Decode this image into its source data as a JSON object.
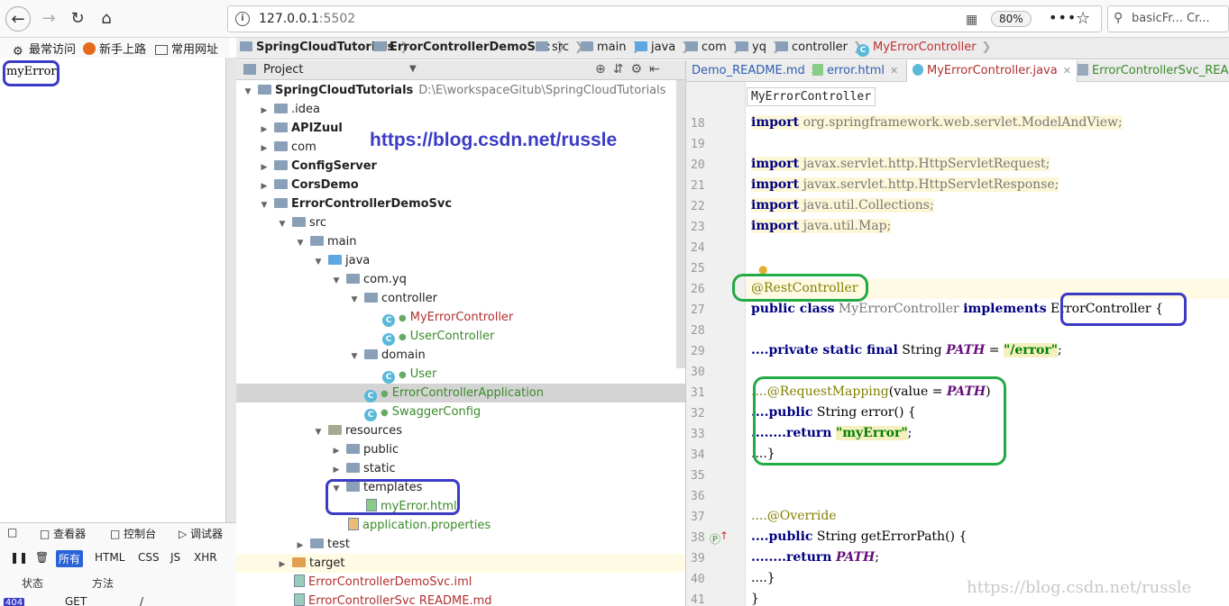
{
  "browser": {
    "url_host": "127.0.0.1",
    "url_port": ":5502",
    "zoom": "80%",
    "search_text": "basicFr... Cr..."
  },
  "bookmarks": [
    {
      "label": "最常访问"
    },
    {
      "label": "新手上路"
    },
    {
      "label": "常用网址"
    }
  ],
  "page": {
    "text": "myError"
  },
  "devtools": {
    "tabs": [
      "查看器",
      "控制台",
      "调试器"
    ],
    "filters": [
      "所有",
      "HTML",
      "CSS",
      "JS",
      "XHR"
    ],
    "columns": [
      "状态",
      "方法"
    ],
    "row": {
      "status": "404",
      "method": "GET",
      "path": "/"
    }
  },
  "breadcrumbs": [
    "SpringCloudTutorials",
    "ErrorControllerDemoSvc",
    "src",
    "main",
    "java",
    "com",
    "yq",
    "controller",
    "MyErrorController"
  ],
  "project": {
    "header": "Project",
    "tree": [
      {
        "label": "SpringCloudTutorials",
        "extra": "D:\\E\\workspaceGitub\\SpringCloudTutorials"
      },
      {
        "label": ".idea"
      },
      {
        "label": "APIZuul"
      },
      {
        "label": "com"
      },
      {
        "label": "ConfigServer"
      },
      {
        "label": "CorsDemo"
      },
      {
        "label": "ErrorControllerDemoSvc"
      },
      {
        "label": "src"
      },
      {
        "label": "main"
      },
      {
        "label": "java"
      },
      {
        "label": "com.yq"
      },
      {
        "label": "controller"
      },
      {
        "label": "MyErrorController"
      },
      {
        "label": "UserController"
      },
      {
        "label": "domain"
      },
      {
        "label": "User"
      },
      {
        "label": "ErrorControllerApplication"
      },
      {
        "label": "SwaggerConfig"
      },
      {
        "label": "resources"
      },
      {
        "label": "public"
      },
      {
        "label": "static"
      },
      {
        "label": "templates"
      },
      {
        "label": "myError.html"
      },
      {
        "label": "application.properties"
      },
      {
        "label": "test"
      },
      {
        "label": "target"
      },
      {
        "label": "ErrorControllerDemoSvc.iml"
      },
      {
        "label": "ErrorControllerSvc README.md"
      }
    ],
    "watermark": "https://blog.csdn.net/russle"
  },
  "editor": {
    "tabs": [
      "Demo_README.md",
      "error.html",
      "MyErrorController.java",
      "ErrorControllerSvc_READM"
    ],
    "tooltip": "MyErrorController",
    "line_numbers": [
      "18",
      "19",
      "20",
      "21",
      "22",
      "23",
      "24",
      "25",
      "26",
      "27",
      "28",
      "29",
      "30",
      "31",
      "32",
      "33",
      "34",
      "35",
      "36",
      "37",
      "38",
      "39",
      "40",
      "41"
    ],
    "lines": {
      "l18_pkg": "org.springframework.web.servlet.ModelAndView;",
      "l20_pkg": "javax.servlet.http.HttpServletRequest;",
      "l21_pkg": "javax.servlet.http.HttpServletResponse;",
      "l22_pkg": "java.util.Collections;",
      "l23_pkg": "java.util.Map;",
      "import_kw": "import",
      "l26_ann": "@RestController",
      "l27_a": "public class",
      "l27_b": " MyErrorController ",
      "l27_c": "implements",
      "l27_d": " ErrorController {",
      "l29_a": "....private static final",
      "l29_b": " String ",
      "l29_c": "PATH",
      "l29_d": " = ",
      "l29_e": "\"/error\"",
      "l29_f": ";",
      "l31_ann": "....@RequestMapping",
      "l31_b": "(value = ",
      "l31_c": "PATH",
      "l31_d": ")",
      "l32_a": "....public",
      "l32_b": " String error() {",
      "l33_a": "........return",
      "l33_b": "\"myError\"",
      "l33_c": ";",
      "l34": "....}",
      "l37_ann": "....@Override",
      "l38_a": "....public",
      "l38_b": " String getErrorPath() {",
      "l39_a": "........return",
      "l39_b": "PATH",
      "l39_c": ";",
      "l40": "....}",
      "l41": "}"
    }
  },
  "watermark_footer": "https://blog.csdn.net/russle"
}
